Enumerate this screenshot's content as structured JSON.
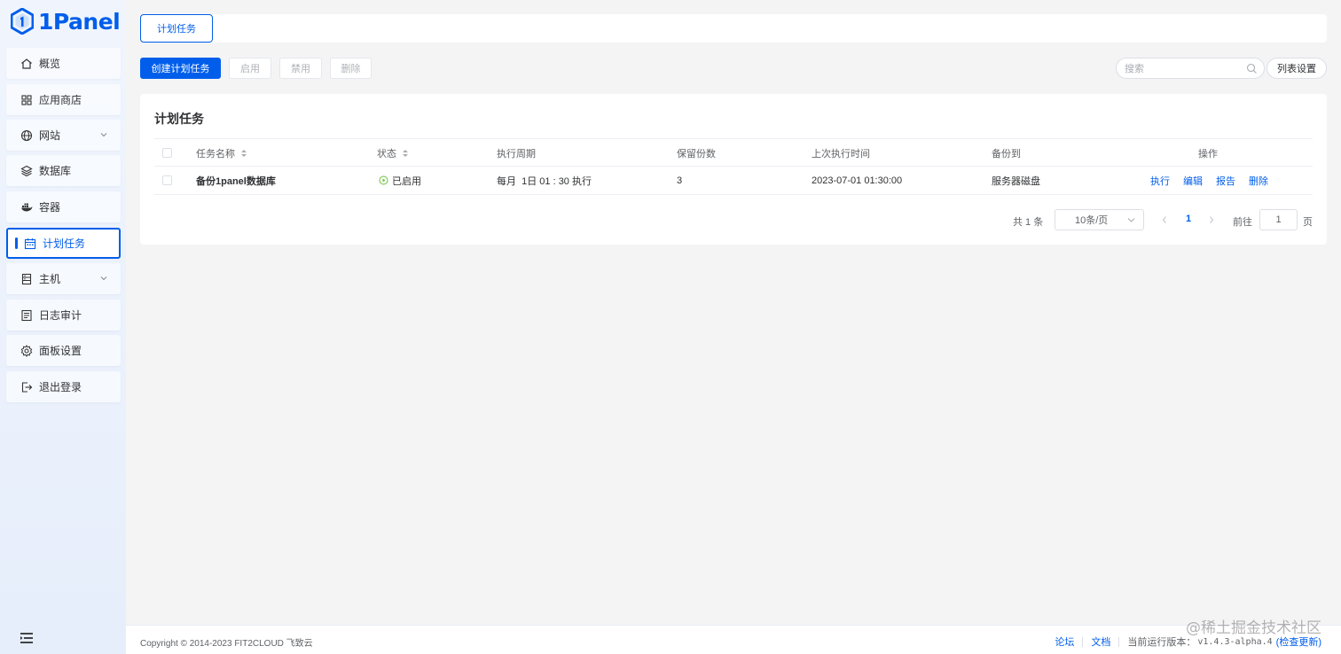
{
  "app": {
    "logo_text": "1Panel"
  },
  "sidebar": {
    "items": [
      {
        "label": "概览",
        "icon": "home-icon"
      },
      {
        "label": "应用商店",
        "icon": "grid-icon"
      },
      {
        "label": "网站",
        "icon": "globe-icon",
        "expandable": true
      },
      {
        "label": "数据库",
        "icon": "layers-icon"
      },
      {
        "label": "容器",
        "icon": "docker-icon"
      },
      {
        "label": "计划任务",
        "icon": "calendar-icon",
        "active": true
      },
      {
        "label": "主机",
        "icon": "server-icon",
        "expandable": true
      },
      {
        "label": "日志审计",
        "icon": "log-icon"
      },
      {
        "label": "面板设置",
        "icon": "gear-icon"
      },
      {
        "label": "退出登录",
        "icon": "logout-icon"
      }
    ]
  },
  "tabs": [
    {
      "label": "计划任务",
      "active": true
    }
  ],
  "toolbar": {
    "create_label": "创建计划任务",
    "enable_label": "启用",
    "disable_label": "禁用",
    "delete_label": "删除",
    "search_placeholder": "搜索",
    "list_settings_label": "列表设置"
  },
  "card": {
    "title": "计划任务"
  },
  "table": {
    "columns": [
      "任务名称",
      "状态",
      "执行周期",
      "保留份数",
      "上次执行时间",
      "备份到",
      "操作"
    ],
    "rows": [
      {
        "name": "备份1panel数据库",
        "status": "已启用",
        "cycle": "每月  1日 01 : 30 执行",
        "retain": "3",
        "last_run": "2023-07-01 01:30:00",
        "target": "服务器磁盘",
        "actions": [
          "执行",
          "编辑",
          "报告",
          "删除"
        ]
      }
    ]
  },
  "pagination": {
    "total": "共 1 条",
    "page_size": "10条/页",
    "current": "1",
    "goto_label": "前往",
    "goto_value": "1",
    "unit": "页"
  },
  "footer": {
    "copyright": "Copyright © 2014-2023 FIT2CLOUD 飞致云",
    "forum": "论坛",
    "docs": "文档",
    "version_label": "当前运行版本：",
    "version": "v1.4.3-alpha.4",
    "check_update": "(检查更新)"
  },
  "watermark": "@稀土掘金技术社区",
  "colors": {
    "primary": "#005eeb",
    "success": "#67c23a",
    "background": "#f4f4f5"
  }
}
